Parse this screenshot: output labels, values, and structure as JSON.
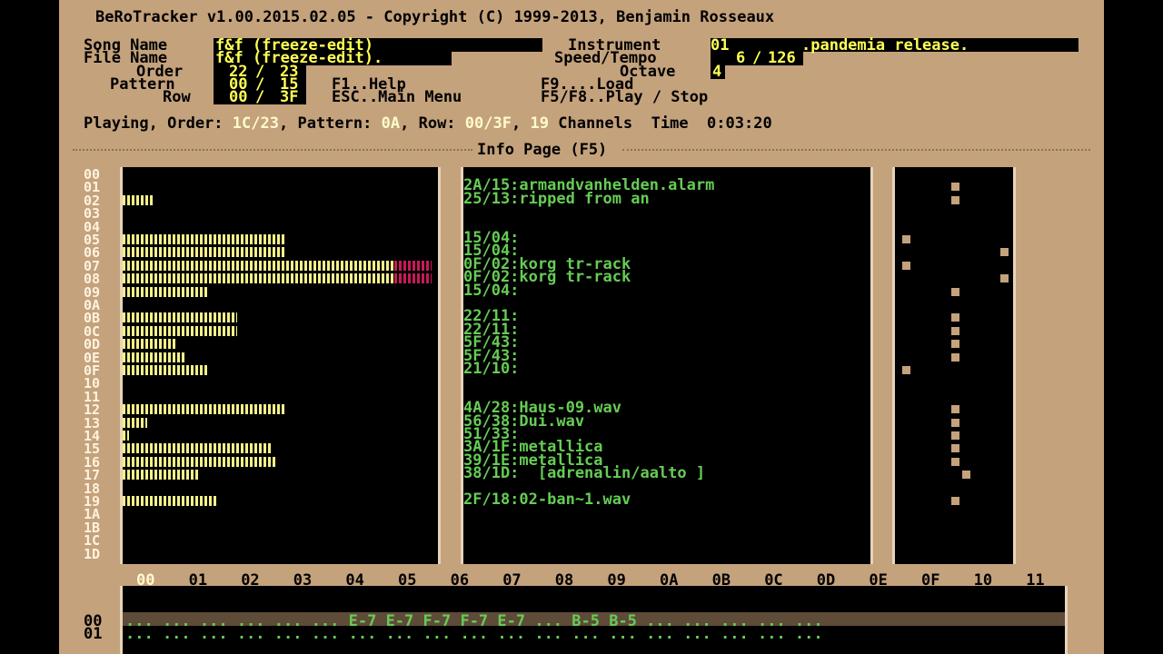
{
  "title": "BeRoTracker v1.00.2015.02.05 - Copyright (C) 1999-2013, Benjamin Rosseaux",
  "labels": {
    "song_name": "Song Name",
    "file_name": "File Name",
    "order": "Order",
    "pattern": "Pattern",
    "row": "Row",
    "instrument": "Instrument",
    "speed_tempo": "Speed/Tempo",
    "octave": "Octave"
  },
  "fields": {
    "song_name": "f&f (freeze-edit)",
    "file_name": "f&f (freeze-edit).",
    "order_cur": "22",
    "order_max": "23",
    "pattern_cur": "00",
    "pattern_max": "15",
    "row_cur": "00",
    "row_max": "3F",
    "instrument_num": "01",
    "instrument_name": ".pandemia release.",
    "speed": "6",
    "tempo": "126",
    "octave": "4"
  },
  "keys": {
    "help": "F1..Help",
    "main_menu": "ESC..Main Menu",
    "load": "F9....Load",
    "play_stop": "F5/F8..Play / Stop"
  },
  "status": {
    "playing_label": "Playing, Order:",
    "order": "1C",
    "order_total": "23",
    "pattern_label": "Pattern:",
    "pattern": "0A",
    "row_label": "Row:",
    "row": "00",
    "row_total": "3F",
    "channels": "19",
    "channels_label": "Channels",
    "time_label": "Time",
    "time": "0:03:20"
  },
  "page_title": "Info Page (F5)",
  "channel_rows": [
    "00",
    "01",
    "02",
    "03",
    "04",
    "05",
    "06",
    "07",
    "08",
    "09",
    "0A",
    "0B",
    "0C",
    "0D",
    "0E",
    "0F",
    "10",
    "11",
    "12",
    "13",
    "14",
    "15",
    "16",
    "17",
    "18",
    "19",
    "1A",
    "1B",
    "1C",
    "1D"
  ],
  "volume_levels": [
    0,
    0,
    0.1,
    0,
    0,
    0.53,
    0.53,
    0.88,
    0.88,
    0.28,
    0,
    0.37,
    0.37,
    0.17,
    0.2,
    0.28,
    0,
    0,
    0.53,
    0.08,
    0.02,
    0.48,
    0.5,
    0.25,
    0,
    0.31,
    0,
    0,
    0,
    0
  ],
  "volume_peaks": [
    0,
    0,
    0,
    0,
    0,
    0,
    0,
    0.12,
    0.12,
    0,
    0,
    0,
    0,
    0,
    0,
    0,
    0,
    0,
    0,
    0,
    0,
    0,
    0,
    0,
    0,
    0,
    0,
    0,
    0,
    0
  ],
  "sample_info": [
    "",
    "2A/15:armandvanhelden.alarm",
    "25/13:ripped from an",
    "",
    "",
    "15/04:",
    "15/04:",
    "0F/02:korg tr-rack",
    "0F/02:korg tr-rack",
    "15/04:",
    "",
    "22/11:",
    "22/11:",
    "5F/43:",
    "5F/43:",
    "21/10:",
    "",
    "",
    "4A/28:Haus-09.wav",
    "56/38:Dui.wav",
    "51/33:",
    "3A/1F:metallica",
    "39/1E:metallica",
    "38/1D:  [adrenalin/aalto ]",
    "",
    "2F/18:02-ban~1.wav",
    "",
    "",
    "",
    ""
  ],
  "panning": [
    null,
    0.5,
    0.5,
    null,
    null,
    0.05,
    0.95,
    0.05,
    0.95,
    0.5,
    null,
    0.5,
    0.5,
    0.5,
    0.5,
    0.05,
    null,
    null,
    0.5,
    0.5,
    0.5,
    0.5,
    0.5,
    0.6,
    null,
    0.5,
    null,
    null,
    null,
    null
  ],
  "pattern_channels": [
    "00",
    "01",
    "02",
    "03",
    "04",
    "05",
    "06",
    "07",
    "08",
    "09",
    "0A",
    "0B",
    "0C",
    "0D",
    "0E",
    "0F",
    "10",
    "11"
  ],
  "pattern_rows": [
    {
      "num": "00",
      "text": "... ... ... ... ... ... E-7 E-7 F-7 F-7 E-7 ... B-5 B-5 ... ... ... ... ..."
    },
    {
      "num": "01",
      "text": "... ... ... ... ... ... ... ... ... ... ... ... ... ... ... ... ... ... ..."
    }
  ],
  "colors": {
    "background": "#c4a27c",
    "field_text": "#ffff55",
    "info_text": "#66cc55",
    "volume_bar": "#f4f08a",
    "volume_peak": "#c81a58"
  }
}
